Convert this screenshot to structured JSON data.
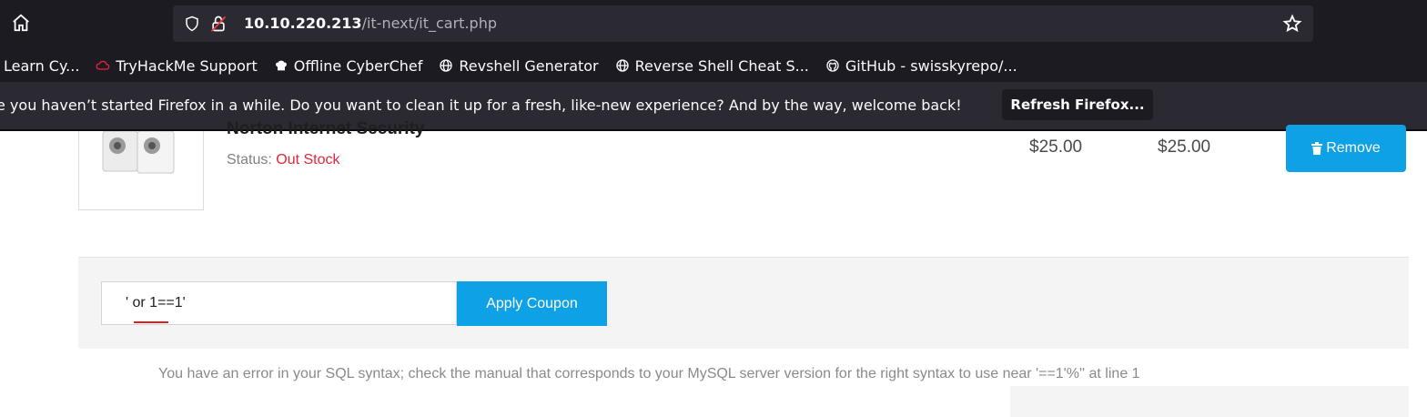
{
  "browser": {
    "url_host": "10.10.220.213",
    "url_path": "/it-next/it_cart.php",
    "bookmarks": [
      {
        "label": "Learn Cy...",
        "icon": "none"
      },
      {
        "label": "TryHackMe Support",
        "icon": "cloud-icon"
      },
      {
        "label": "Offline CyberChef",
        "icon": "chef-hat-icon"
      },
      {
        "label": "Revshell Generator",
        "icon": "globe-icon"
      },
      {
        "label": "Reverse Shell Cheat S...",
        "icon": "globe-icon"
      },
      {
        "label": "GitHub - swisskyrepo/...",
        "icon": "github-icon"
      }
    ],
    "notification": {
      "text": "e you haven’t started Firefox in a while. Do you want to clean it up for a fresh, like-new experience? And by the way, welcome back!",
      "button_label": "Refresh Firefox..."
    }
  },
  "cart_item": {
    "name": "Norton Internet Security",
    "status_label": "Status:",
    "status_value": "Out Stock",
    "unit_price": "$25.00",
    "total_price": "$25.00",
    "remove_label": "Remove"
  },
  "coupon": {
    "input_value": "' or 1==1'",
    "apply_label": "Apply Coupon"
  },
  "error_message": "You have an error in your SQL syntax; check the manual that corresponds to your MySQL server version for the right syntax to use near '==1'%'' at line 1",
  "colors": {
    "accent": "#0ea1e6",
    "status_out": "#e8233b",
    "chrome_dark": "#1c1b22"
  }
}
